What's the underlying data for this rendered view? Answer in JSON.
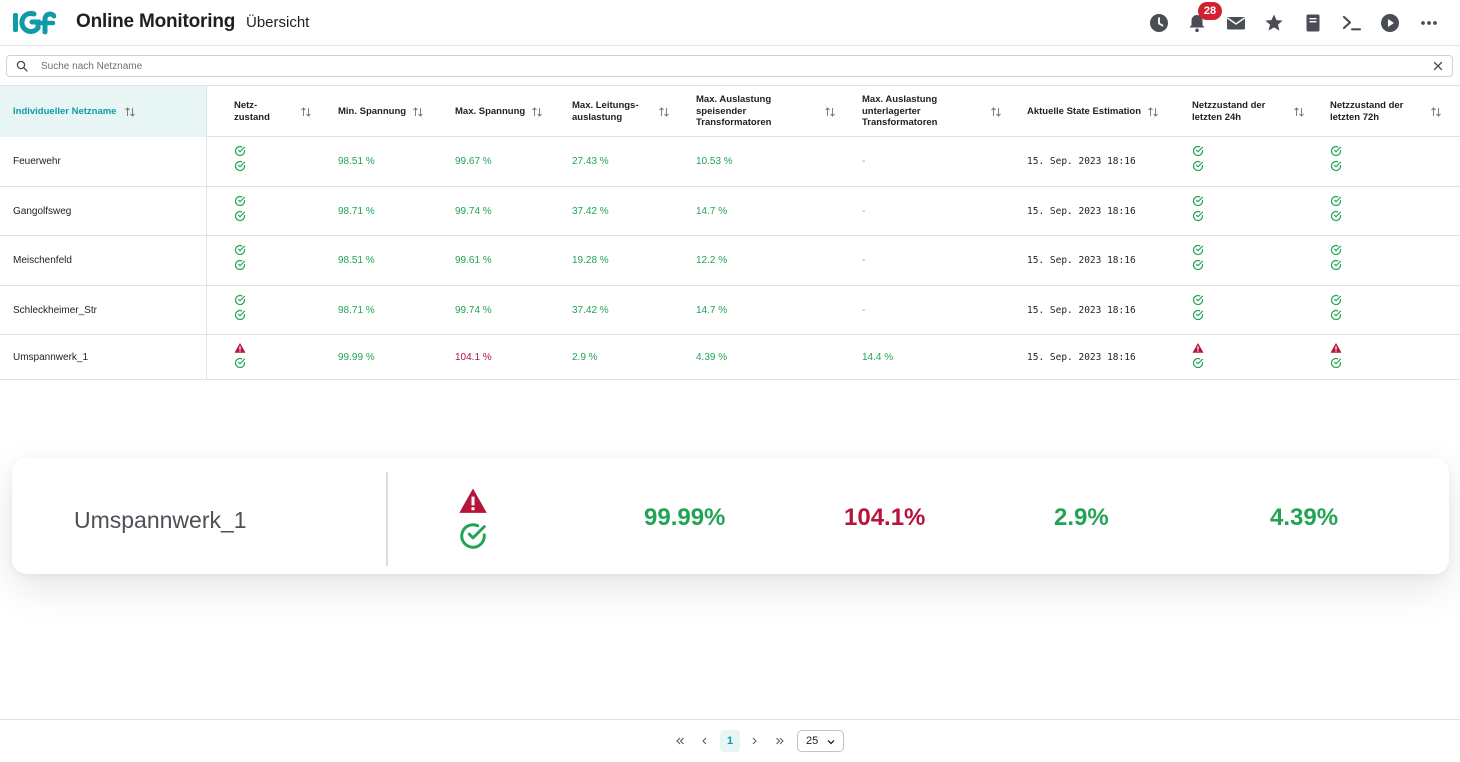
{
  "header": {
    "app_title": "Online Monitoring",
    "page_title": "Übersicht",
    "notification_count": "28",
    "icons": [
      "history-icon",
      "bell-icon",
      "mail-icon",
      "star-icon",
      "book-icon",
      "terminal-icon",
      "play-icon",
      "more-icon"
    ]
  },
  "search": {
    "placeholder": "Suche nach Netzname",
    "value": ""
  },
  "table": {
    "columns": [
      "Individueller Netzname",
      "Netz-\nzustand",
      "Min. Spannung",
      "Max. Spannung",
      "Max. Leitungs-\nauslastung",
      "Max. Auslastung\nspeisender\nTransformatoren",
      "Max. Auslastung\nunterlagerter\nTransformatoren",
      "Aktuelle State Estimation",
      "Netzzustand der\nletzten 24h",
      "Netzzustand der\nletzten 72h"
    ],
    "rows": [
      {
        "name": "Feuerwehr",
        "status": [
          "ok",
          "ok"
        ],
        "min_spannung": "98.51 %",
        "max_spannung": "99.67 %",
        "max_spannung_state": "green",
        "leitung": "27.43 %",
        "speisend": "10.53 %",
        "unterlagert": "-",
        "unterlagert_state": "gray",
        "state_estimation": "15. Sep. 2023 18:16",
        "status24": [
          "ok",
          "ok"
        ],
        "status72": [
          "ok",
          "ok"
        ]
      },
      {
        "name": "Gangolfsweg",
        "status": [
          "ok",
          "ok"
        ],
        "min_spannung": "98.71 %",
        "max_spannung": "99.74 %",
        "max_spannung_state": "green",
        "leitung": "37.42 %",
        "speisend": "14.7 %",
        "unterlagert": "-",
        "unterlagert_state": "gray",
        "state_estimation": "15. Sep. 2023 18:16",
        "status24": [
          "ok",
          "ok"
        ],
        "status72": [
          "ok",
          "ok"
        ]
      },
      {
        "name": "Meischenfeld",
        "status": [
          "ok",
          "ok"
        ],
        "min_spannung": "98.51 %",
        "max_spannung": "99.61 %",
        "max_spannung_state": "green",
        "leitung": "19.28 %",
        "speisend": "12.2 %",
        "unterlagert": "-",
        "unterlagert_state": "gray",
        "state_estimation": "15. Sep. 2023 18:16",
        "status24": [
          "ok",
          "ok"
        ],
        "status72": [
          "ok",
          "ok"
        ]
      },
      {
        "name": "Schleckheimer_Str",
        "status": [
          "ok",
          "ok"
        ],
        "min_spannung": "98.71 %",
        "max_spannung": "99.74 %",
        "max_spannung_state": "green",
        "leitung": "37.42 %",
        "speisend": "14.7 %",
        "unterlagert": "-",
        "unterlagert_state": "gray",
        "state_estimation": "15. Sep. 2023 18:16",
        "status24": [
          "ok",
          "ok"
        ],
        "status72": [
          "ok",
          "ok"
        ]
      },
      {
        "name": "Umspannwerk_1",
        "status": [
          "warning",
          "ok"
        ],
        "min_spannung": "99.99 %",
        "max_spannung": "104.1 %",
        "max_spannung_state": "red",
        "leitung": "2.9 %",
        "speisend": "4.39 %",
        "unterlagert": "14.4 %",
        "unterlagert_state": "green",
        "state_estimation": "15. Sep. 2023 18:16",
        "status24": [
          "warning",
          "ok"
        ],
        "status72": [
          "warning",
          "ok"
        ]
      }
    ]
  },
  "highlight": {
    "name": "Umspannwerk_1",
    "status": [
      "warning",
      "ok"
    ],
    "values": [
      {
        "text": "99.99%",
        "state": "green"
      },
      {
        "text": "104.1%",
        "state": "red"
      },
      {
        "text": "2.9%",
        "state": "green"
      },
      {
        "text": "4.39%",
        "state": "green"
      }
    ]
  },
  "pagination": {
    "current_page": "1",
    "page_size": "25"
  },
  "colors": {
    "accent": "#0e9aa7",
    "ok": "#22a455",
    "warning": "#b5143b",
    "badge": "#d32030"
  }
}
